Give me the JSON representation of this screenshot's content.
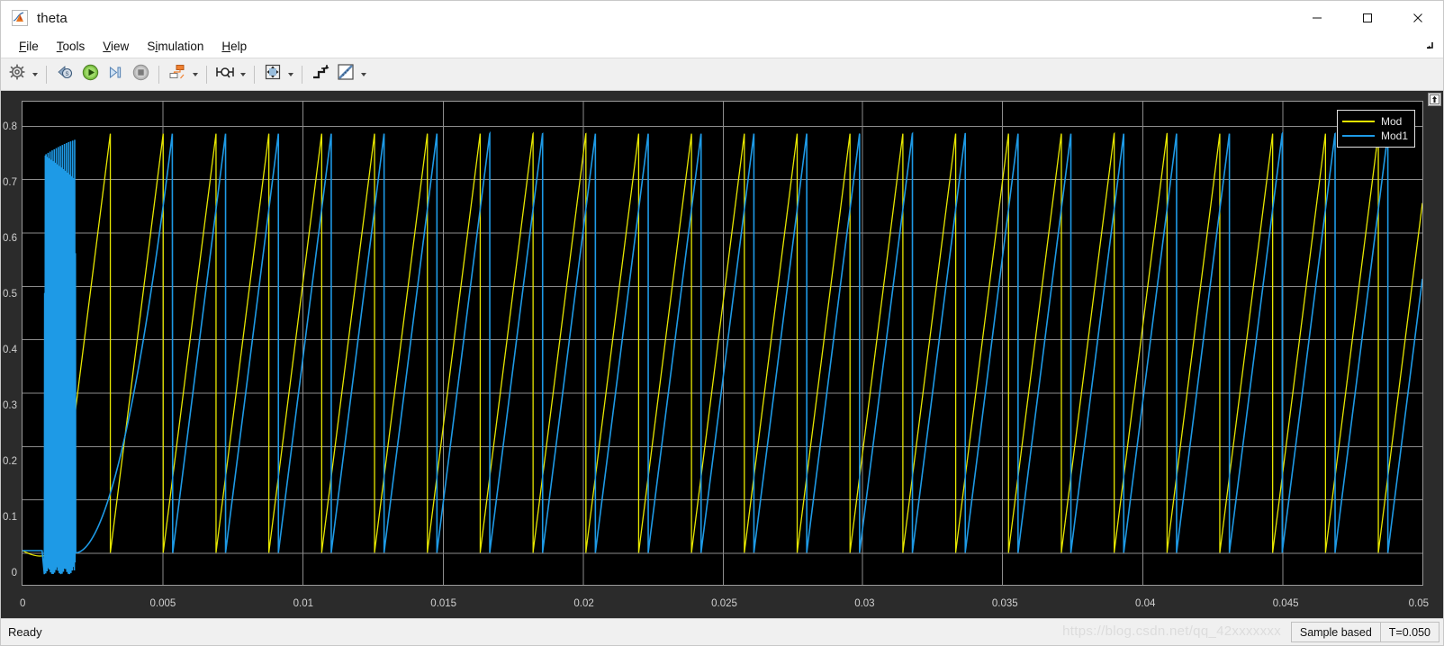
{
  "window": {
    "title": "theta",
    "app_icon": "matlab-simulink-scope-icon",
    "controls": {
      "minimize": "—",
      "maximize": "☐",
      "close": "✕"
    }
  },
  "menubar": {
    "items": [
      {
        "label": "File",
        "mnemonic": "F"
      },
      {
        "label": "Tools",
        "mnemonic": "T"
      },
      {
        "label": "View",
        "mnemonic": "V"
      },
      {
        "label": "Simulation",
        "mnemonic": "i"
      },
      {
        "label": "Help",
        "mnemonic": "H"
      }
    ],
    "corner_icon": "restore-arrow-icon"
  },
  "toolbar": {
    "groups": [
      [
        {
          "name": "configuration-properties-button",
          "icon": "gear-icon",
          "has_dropdown": true
        }
      ],
      [
        {
          "name": "simulink-step-back-button",
          "icon": "step-back-icon",
          "has_dropdown": false
        },
        {
          "name": "run-button",
          "icon": "play-icon",
          "has_dropdown": false
        },
        {
          "name": "step-forward-button",
          "icon": "step-forward-icon",
          "has_dropdown": false
        },
        {
          "name": "stop-button",
          "icon": "stop-icon",
          "has_dropdown": false
        }
      ],
      [
        {
          "name": "highlight-signal-button",
          "icon": "signal-hierarchy-icon",
          "has_dropdown": true
        }
      ],
      [
        {
          "name": "cursor-measurements-button",
          "icon": "cursor-measure-icon",
          "has_dropdown": true
        }
      ],
      [
        {
          "name": "zoom-button",
          "icon": "zoom-fit-icon",
          "has_dropdown": true
        }
      ],
      [
        {
          "name": "autoscale-button",
          "icon": "autoscale-icon",
          "has_dropdown": false
        },
        {
          "name": "style-button",
          "icon": "ruler-style-icon",
          "has_dropdown": true
        }
      ]
    ]
  },
  "scope": {
    "dock_button": "undock-icon",
    "legend": {
      "entries": [
        {
          "label": "Mod",
          "color": "#e8e800"
        },
        {
          "label": "Mod1",
          "color": "#1e9ae6"
        }
      ]
    }
  },
  "statusbar": {
    "ready_text": "Ready",
    "watermark": "https://blog.csdn.net/qq_42xxxxxxx",
    "cells": [
      {
        "name": "sample-mode-cell",
        "text": "Sample based"
      },
      {
        "name": "simulation-time-cell",
        "text": "T=0.050"
      }
    ]
  },
  "chart_data": {
    "type": "line",
    "title": "",
    "xlabel": "",
    "ylabel": "",
    "xlim": [
      0,
      0.05
    ],
    "ylim": [
      -0.06,
      0.845
    ],
    "xticks": [
      0,
      0.005,
      0.01,
      0.015,
      0.02,
      0.025,
      0.03,
      0.035,
      0.04,
      0.045,
      0.05
    ],
    "xticklabels": [
      "0",
      "0.005",
      "0.01",
      "0.015",
      "0.02",
      "0.025",
      "0.03",
      "0.035",
      "0.04",
      "0.045",
      "0.05"
    ],
    "yticks": [
      0,
      0.1,
      0.2,
      0.3,
      0.4,
      0.5,
      0.6,
      0.7,
      0.8
    ],
    "yticklabels": [
      "0",
      "0.1",
      "0.2",
      "0.3",
      "0.4",
      "0.5",
      "0.6",
      "0.7",
      "0.8"
    ],
    "grid": true,
    "grid_color": "#8c8c8c",
    "background": "#000000",
    "legend_position": "top-right",
    "waveform": {
      "shape": "sawtooth",
      "amplitude_min": 0.0,
      "amplitude_max": 0.785,
      "period": 0.001887,
      "cycles_visible": 26,
      "description": "Two nearly-overlapping sawtooth ramps rising from 0 to ~0.785 (2*pi/8) then resetting; a startup transient with high-frequency oscillation occupies roughly t = 0 to 0.005 s."
    },
    "series": [
      {
        "name": "Mod",
        "color": "#e8e800",
        "phase_offset": 0.0,
        "transient_end": 0.0016,
        "note": "yellow trace; reaches steady sawtooth almost immediately"
      },
      {
        "name": "Mod1",
        "color": "#1e9ae6",
        "phase_offset": 6e-05,
        "transient_end": 0.0053,
        "note": "blue trace; large oscillatory transient between t=0.0008 and t=0.0017, then lags slightly behind Mod"
      }
    ]
  }
}
